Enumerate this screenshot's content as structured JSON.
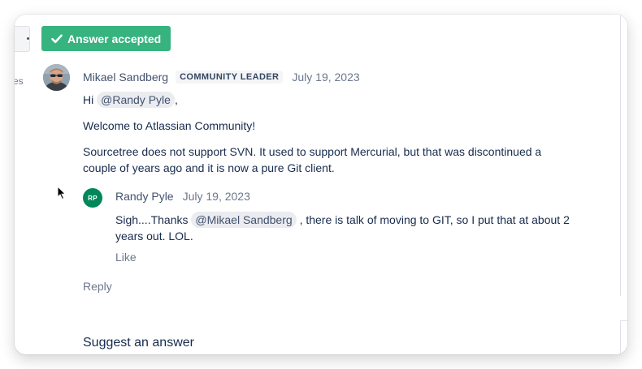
{
  "badge": {
    "label": "Answer accepted",
    "color": "#36b37e",
    "icon": "check-icon"
  },
  "left_stub": {
    "text": "es"
  },
  "answer": {
    "author": "Mikael Sandberg",
    "role_badge": "COMMUNITY LEADER",
    "date": "July 19, 2023",
    "greeting_prefix": "Hi",
    "greeting_mention": "@Randy Pyle",
    "greeting_suffix": ",",
    "paragraph_1": "Welcome to Atlassian Community!",
    "paragraph_2_line_1": "Sourcetree does not support SVN. It used to support Mercurial, but that was discontinued a",
    "paragraph_2_line_2": "couple of years ago and it is now a pure Git client."
  },
  "reply": {
    "initials": "RP",
    "avatar_color": "#00875a",
    "author": "Randy Pyle",
    "date": "July 19, 2023",
    "text_prefix": "Sigh....Thanks",
    "mention": "@Mikael Sandberg",
    "text_suffix": ", there is talk of moving to GIT, so I put that at about 2",
    "text_line_2": "years out. LOL.",
    "like_label": "Like"
  },
  "actions": {
    "reply_label": "Reply"
  },
  "suggest": {
    "heading": "Suggest an answer"
  }
}
